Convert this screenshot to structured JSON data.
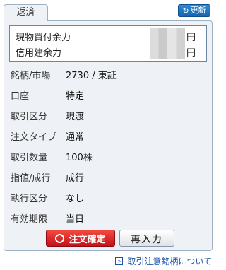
{
  "tab": {
    "label": "返済"
  },
  "update_button": {
    "icon": "refresh-icon",
    "label": "更新"
  },
  "power": {
    "rows": [
      {
        "label": "現物買付余力",
        "unit": "円"
      },
      {
        "label": "信用建余力",
        "unit": "円"
      }
    ]
  },
  "details": {
    "rows": [
      {
        "label": "銘柄/市場",
        "value": "2730 / 東証"
      },
      {
        "label": "口座",
        "value": "特定"
      },
      {
        "label": "取引区分",
        "value": "現渡"
      },
      {
        "label": "注文タイプ",
        "value": "通常"
      },
      {
        "label": "取引数量",
        "value": "100株"
      },
      {
        "label": "指値/成行",
        "value": "成行"
      },
      {
        "label": "執行区分",
        "value": "なし"
      },
      {
        "label": "有効期限",
        "value": "当日"
      }
    ]
  },
  "buttons": {
    "confirm": "注文確定",
    "reenter": "再入力"
  },
  "notice_link": {
    "icon": "double-arrow-icon",
    "label": "取引注意銘柄について"
  },
  "colors": {
    "confirm": "#d8202a",
    "update": "#1f73c4",
    "link": "#1a54a8",
    "panel": "#eef2f6"
  }
}
